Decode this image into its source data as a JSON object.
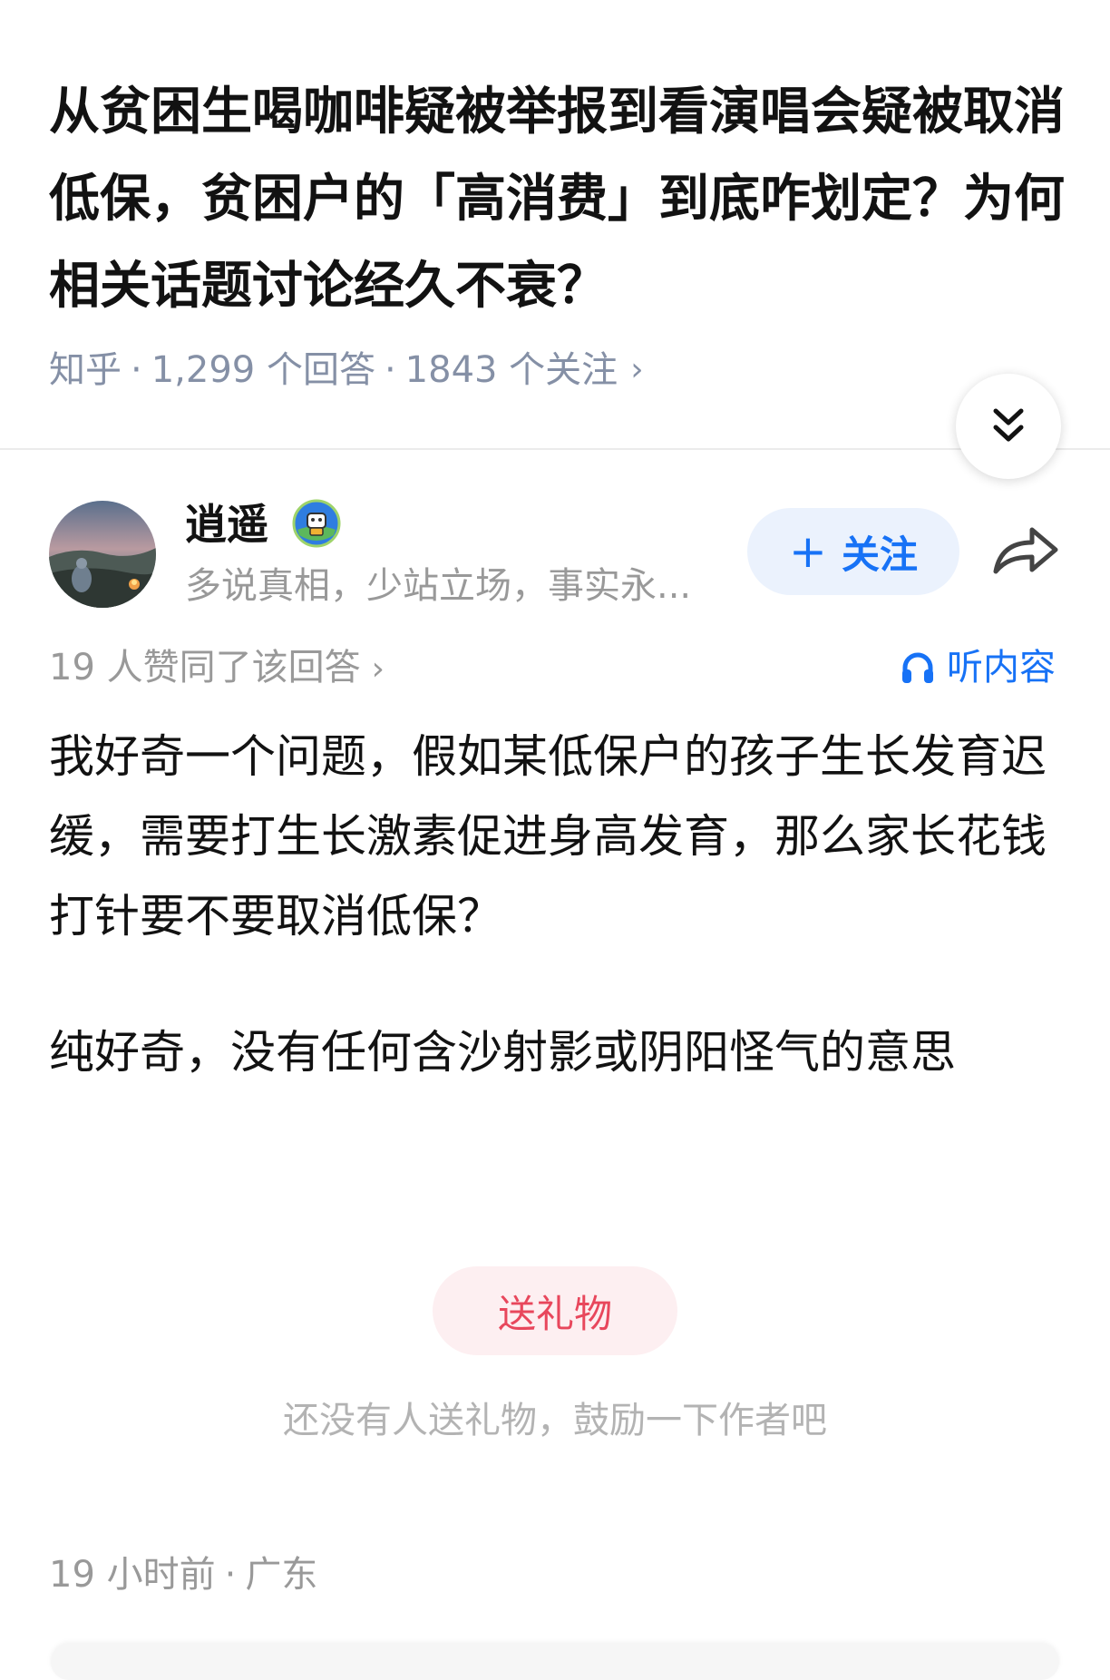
{
  "question": {
    "title": "从贫困生喝咖啡疑被举报到看演唱会疑被取消低保，贫困户的「高消费」到底咋划定？为何相关话题讨论经久不衰？",
    "source": "知乎",
    "separator": "·",
    "answer_count": "1,299 个回答",
    "follower_count": "1843 个关注",
    "chevron": "›",
    "expand_icon": "double-chevron-down-icon"
  },
  "answer": {
    "author": {
      "name": "逍遥",
      "bio": "多说真相，少站立场，事实永...",
      "avatar_icon": "avatar-campfire-landscape",
      "badge_icon": "cartoon-badge-icon"
    },
    "follow_button": {
      "plus": "+",
      "label": "关注"
    },
    "share_icon": "share-arrow-icon",
    "vote_summary": "19 人赞同了该回答",
    "listen_label": "听内容",
    "paragraphs": [
      "我好奇一个问题，假如某低保户的孩子生长发育迟缓，需要打生长激素促进身高发育，那么家长花钱打针要不要取消低保？",
      "纯好奇，没有任何含沙射影或阴阳怪气的意思"
    ],
    "gift_button": "送礼物",
    "gift_hint": "还没有人送礼物，鼓励一下作者吧",
    "time": "19 小时前",
    "location": "广东"
  },
  "colors": {
    "text": "#121212",
    "meta": "#8590a6",
    "secondary": "#999999",
    "accent_blue": "#1772f6",
    "follow_bg": "#ebf2fd",
    "gift_red": "#e8475c",
    "gift_bg": "#fdeff1"
  }
}
